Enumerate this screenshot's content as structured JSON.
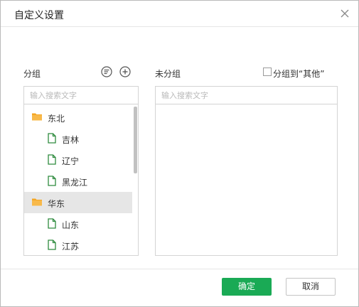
{
  "dialog": {
    "title": "自定义设置",
    "close_icon": "close-icon"
  },
  "left_panel": {
    "label": "分组",
    "sort_icon": "sort-list-icon",
    "add_icon": "add-circle-icon",
    "search_placeholder": "输入搜索文字",
    "tree": [
      {
        "label": "东北",
        "type": "folder",
        "selected": false
      },
      {
        "label": "吉林",
        "type": "file",
        "selected": false
      },
      {
        "label": "辽宁",
        "type": "file",
        "selected": false
      },
      {
        "label": "黑龙江",
        "type": "file",
        "selected": false
      },
      {
        "label": "华东",
        "type": "folder",
        "selected": true
      },
      {
        "label": "山东",
        "type": "file",
        "selected": false
      },
      {
        "label": "江苏",
        "type": "file",
        "selected": false
      }
    ]
  },
  "right_panel": {
    "label": "未分组",
    "checkbox_label": "分组到“其他”",
    "checkbox_checked": false,
    "search_placeholder": "输入搜索文字"
  },
  "footer": {
    "ok_label": "确定",
    "cancel_label": "取消"
  },
  "colors": {
    "accent": "#1aaa55",
    "folder": "#f5a623",
    "file": "#2e8b3e"
  }
}
